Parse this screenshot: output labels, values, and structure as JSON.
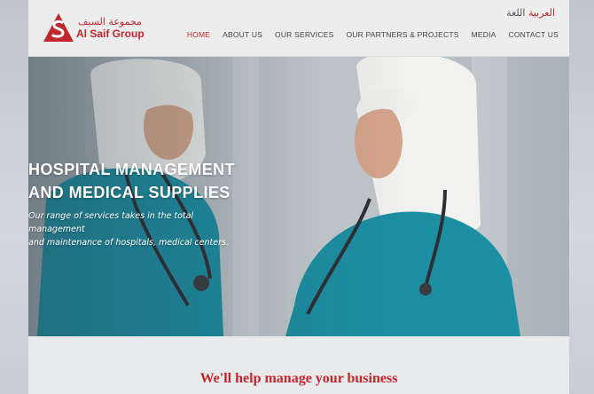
{
  "brand": {
    "name_ar": "مجموعة السيف",
    "name_en": "Al Saif Group",
    "logo_letter": "S",
    "color": "#c0282e"
  },
  "language": {
    "label": "اللغة",
    "value": "العربية"
  },
  "nav": {
    "items": [
      {
        "label": "HOME",
        "active": true
      },
      {
        "label": "ABOUT US",
        "active": false
      },
      {
        "label": "OUR SERVICES",
        "active": false
      },
      {
        "label": "OUR PARTNERS & PROJECTS",
        "active": false
      },
      {
        "label": "MEDIA",
        "active": false
      },
      {
        "label": "CONTACT US",
        "active": false
      }
    ]
  },
  "hero": {
    "title_line1": "HOSPITAL MANAGEMENT",
    "title_line2": "AND MEDICAL SUPPLIES",
    "description_line1": "Our range of services takes in the total management",
    "description_line2": "and maintenance of hospitals, medical centers."
  },
  "section": {
    "heading": "We'll help manage your business"
  },
  "colors": {
    "accent": "#c0282e",
    "scrubs": "#1c8fa3",
    "hijab": "#f2f2f0"
  }
}
